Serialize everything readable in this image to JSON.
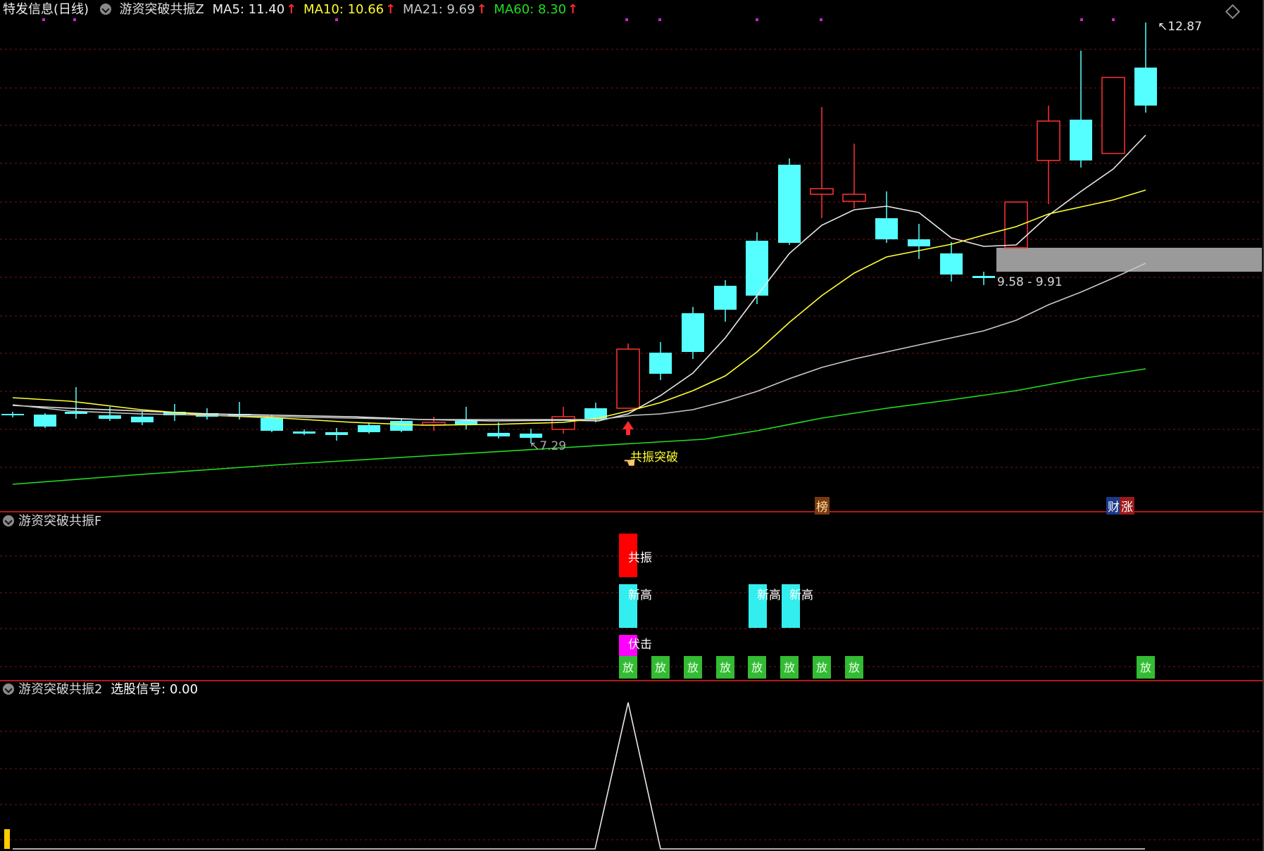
{
  "header": {
    "title": "特发信息(日线)",
    "indicator": "游资突破共振Z",
    "ma": [
      {
        "label": "MA5: 11.40",
        "color": "#e8e8e8"
      },
      {
        "label": "MA10: 10.66",
        "color": "#ffff33"
      },
      {
        "label": "MA21: 9.69",
        "color": "#c8c8c8"
      },
      {
        "label": "MA60: 8.30",
        "color": "#22dd22"
      }
    ],
    "trend_arrow": "↑"
  },
  "main_chart": {
    "price_high_label": "12.87",
    "price_low_label": "7.29",
    "zone_label": "9.58 - 9.91",
    "signal_label": "共振突破",
    "tag_bang": "榜",
    "tag_cai": "财",
    "tag_zhang": "涨"
  },
  "panel_f": {
    "title": "游资突破共振F",
    "gongzhen": "共振",
    "xingao": "新高",
    "fuji": "伏击",
    "fang": "放"
  },
  "panel_2": {
    "title": "游资突破共振2",
    "signal_label": "选股信号:",
    "signal_value": "0.00"
  },
  "colors": {
    "up": "#ff3333",
    "down": "#55ffff",
    "ma5": "#e8e8e8",
    "ma10": "#ffff33",
    "ma21": "#c8c8c8",
    "ma60": "#22dd22",
    "grid": "#7a1515",
    "separator": "#b01818",
    "fuji": "#ff00ff",
    "fang": "#33bb33"
  }
}
